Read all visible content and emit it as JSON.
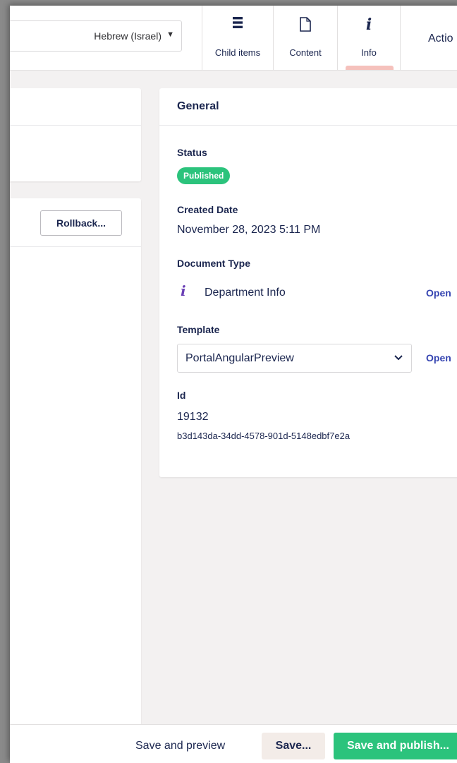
{
  "header": {
    "language": "Hebrew (Israel)",
    "tabs": [
      {
        "label": "Child items",
        "icon": "list-icon"
      },
      {
        "label": "Content",
        "icon": "document-icon"
      },
      {
        "label": "Info",
        "icon": "info-icon"
      }
    ],
    "actions_label": "Actio"
  },
  "history": {
    "rollback_label": "Rollback..."
  },
  "general": {
    "title": "General",
    "status_label": "Status",
    "status_value": "Published",
    "created_label": "Created Date",
    "created_value": "November 28, 2023 5:11 PM",
    "doctype_label": "Document Type",
    "doctype_value": "Department Info",
    "doctype_icon": "info-icon",
    "open_label": "Open",
    "template_label": "Template",
    "template_value": "PortalAngularPreview",
    "id_label": "Id",
    "id_value": "19132",
    "guid_value": "b3d143da-34dd-4578-901d-5148edbf7e2a"
  },
  "footer": {
    "preview_label": "Save and preview",
    "save_label": "Save...",
    "publish_label": "Save and publish..."
  },
  "colors": {
    "accent": "#2bc37c",
    "text": "#1b264f",
    "link": "#3544b1",
    "active_tab_indicator": "#f5c1bc",
    "doctype_icon": "#6a3fb5"
  }
}
